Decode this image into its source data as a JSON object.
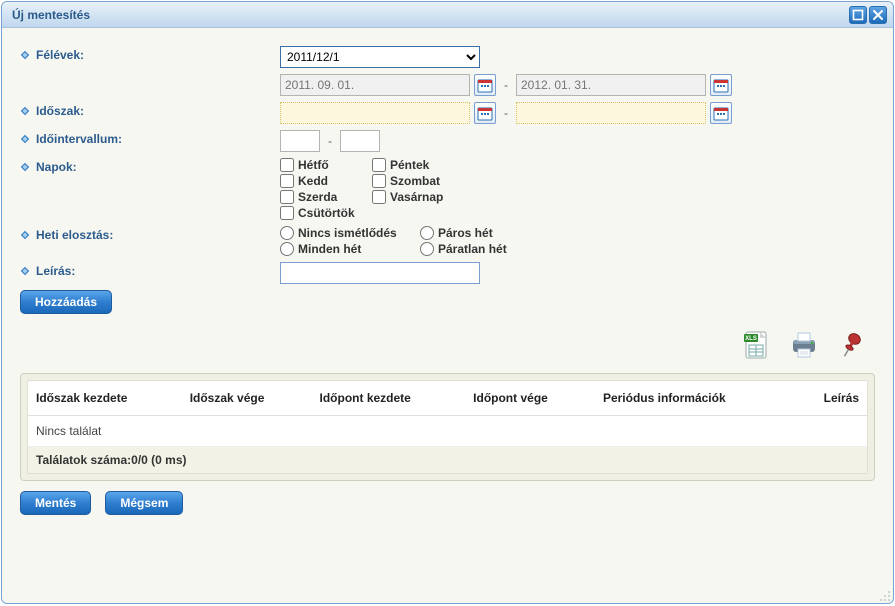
{
  "window": {
    "title": "Új mentesítés"
  },
  "labels": {
    "semesters": "Félévek:",
    "period": "Időszak:",
    "interval": "Időintervallum:",
    "days": "Napok:",
    "weekly": "Heti elosztás:",
    "description": "Leírás:"
  },
  "semester": {
    "selected": "2011/12/1"
  },
  "semester_dates": {
    "from_placeholder": "2011. 09. 01.",
    "to_placeholder": "2012. 01. 31."
  },
  "period_dates": {
    "from": "",
    "to": ""
  },
  "time_interval": {
    "from": "",
    "to": ""
  },
  "separator": "-",
  "days": {
    "mon": "Hétfő",
    "tue": "Kedd",
    "wed": "Szerda",
    "thu": "Csütörtök",
    "fri": "Péntek",
    "sat": "Szombat",
    "sun": "Vasárnap"
  },
  "weekly_options": {
    "none": "Nincs ismétlődés",
    "even": "Páros hét",
    "every": "Minden hét",
    "odd": "Páratlan hét"
  },
  "description_value": "",
  "buttons": {
    "add": "Hozzáadás",
    "save": "Mentés",
    "cancel": "Mégsem"
  },
  "grid": {
    "columns": {
      "period_start": "Időszak kezdete",
      "period_end": "Időszak vége",
      "time_start": "Időpont kezdete",
      "time_end": "Időpont vége",
      "period_info": "Periódus információk",
      "description": "Leírás"
    },
    "empty": "Nincs találat",
    "footer": "Találatok száma:0/0 (0 ms)"
  }
}
